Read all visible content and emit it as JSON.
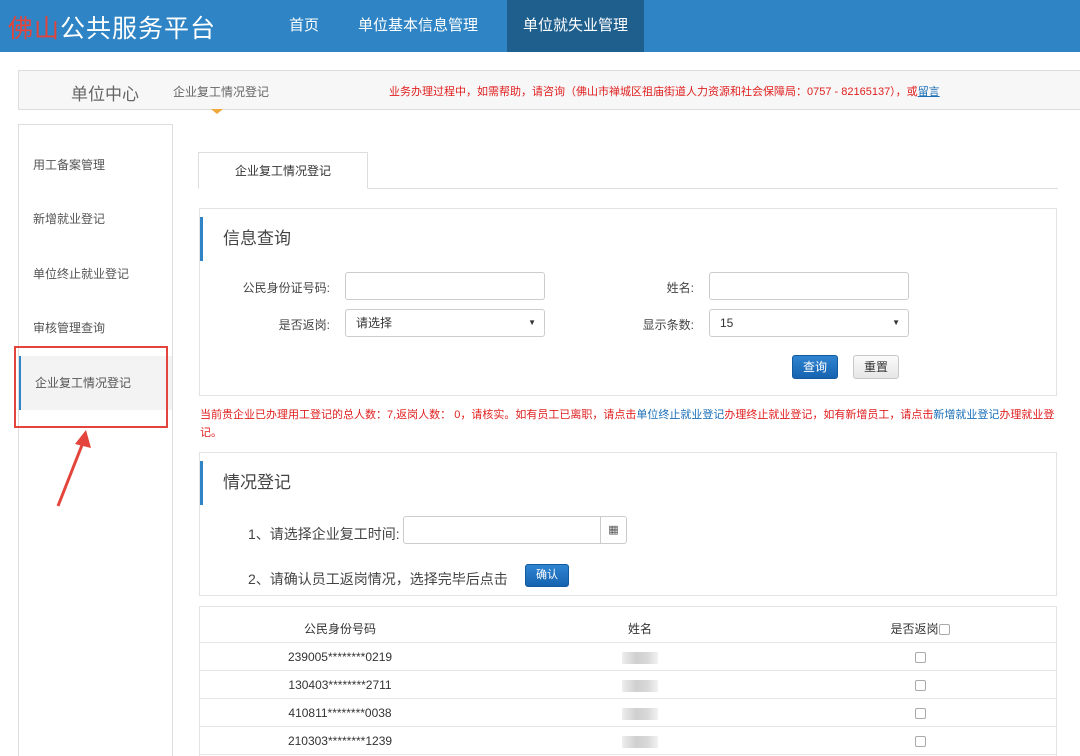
{
  "app": {
    "logo_city": "佛山",
    "logo_rest": "公共服务平台"
  },
  "nav": {
    "items": [
      {
        "label": "首页"
      },
      {
        "label": "单位基本信息管理"
      },
      {
        "label": "单位就失业管理"
      }
    ],
    "active_index": 2
  },
  "header": {
    "title": "单位中心",
    "breadcrumb": "企业复工情况登记",
    "notice_prefix": "业务办理过程中，如需帮助，请咨询（佛山市禅城区祖庙街道人力资源和社会保障局：0757 - 82165137），或",
    "notice_link": "留言"
  },
  "sidebar": {
    "items": [
      {
        "label": "用工备案管理"
      },
      {
        "label": "新增就业登记"
      },
      {
        "label": "单位终止就业登记"
      },
      {
        "label": "审核管理查询"
      },
      {
        "label": "企业复工情况登记"
      }
    ],
    "active_index": 4
  },
  "tab": {
    "label": "企业复工情况登记"
  },
  "query": {
    "title": "信息查询",
    "id_label": "公民身份证号码:",
    "id_value": "",
    "name_label": "姓名:",
    "name_value": "",
    "return_label": "是否返岗:",
    "return_selected": "请选择",
    "rows_label": "显示条数:",
    "rows_selected": "15",
    "search_button": "查询",
    "reset_button": "重置"
  },
  "notice": {
    "p1": "当前贵企业已办理用工登记的总人数：7,返岗人数： 0，请核实。如有员工已离职，请点击",
    "link1": "单位终止就业登记",
    "p2": "办理终止就业登记，如有新增员工，请点击",
    "link2": "新增就业登记",
    "p3": "办理就业登记。"
  },
  "register": {
    "title": "情况登记",
    "step1": "1、请选择企业复工时间:",
    "date_value": "",
    "step2": "2、请确认员工返岗情况，选择完毕后点击",
    "confirm_button": "确认"
  },
  "table": {
    "headers": [
      "公民身份号码",
      "姓名",
      "是否返岗"
    ],
    "rows": [
      {
        "id": "239005********0219",
        "returned": false
      },
      {
        "id": "130403********2711",
        "returned": false
      },
      {
        "id": "410811********0038",
        "returned": false
      },
      {
        "id": "210303********1239",
        "returned": false
      }
    ]
  },
  "colors": {
    "nav_bg": "#2e84c4",
    "nav_active": "#1f5f8d",
    "logo_city": "#e3443b",
    "notice_red": "#e02020",
    "link_blue": "#1a6fb8",
    "annotation_red": "#e3443b"
  }
}
